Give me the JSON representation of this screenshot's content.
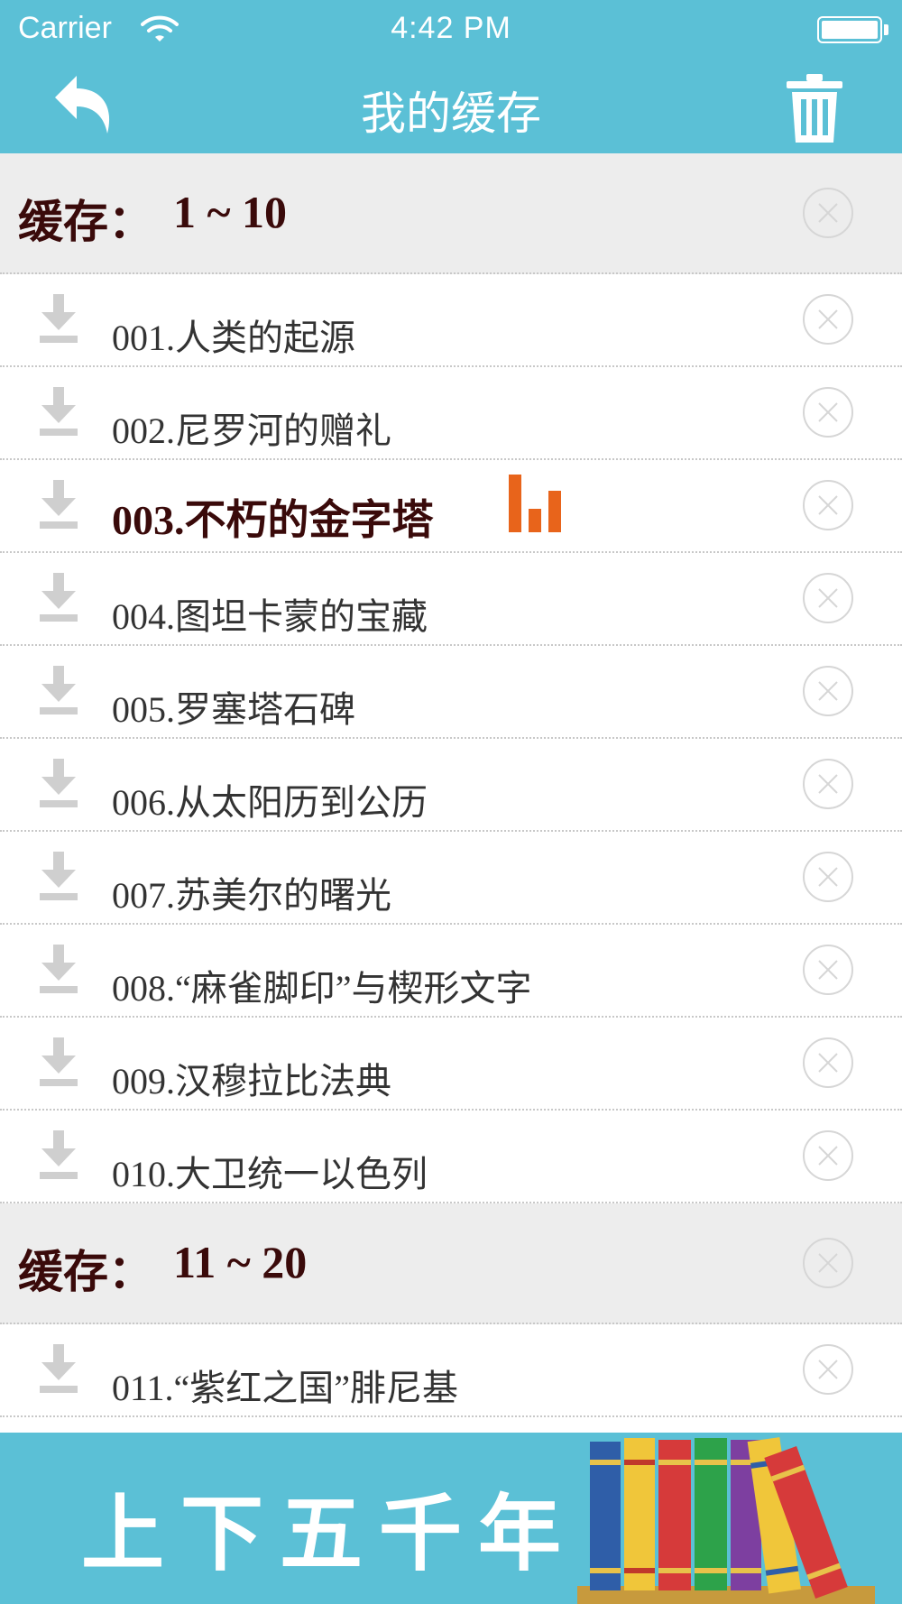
{
  "status_bar": {
    "carrier": "Carrier",
    "time": "4:42 PM"
  },
  "nav": {
    "title": "我的缓存",
    "back_icon": "back-arrow-icon",
    "trash_icon": "trash-icon"
  },
  "sections": [
    {
      "label": "缓存：",
      "range": "1 ~ 10",
      "items": [
        {
          "title": "001.人类的起源",
          "active": false
        },
        {
          "title": "002.尼罗河的赠礼",
          "active": false
        },
        {
          "title": "003.不朽的金字塔",
          "active": true
        },
        {
          "title": "004.图坦卡蒙的宝藏",
          "active": false
        },
        {
          "title": "005.罗塞塔石碑",
          "active": false
        },
        {
          "title": "006.从太阳历到公历",
          "active": false
        },
        {
          "title": "007.苏美尔的曙光",
          "active": false
        },
        {
          "title": "008.“麻雀脚印”与楔形文字",
          "active": false
        },
        {
          "title": "009.汉穆拉比法典",
          "active": false
        },
        {
          "title": "010.大卫统一以色列",
          "active": false
        }
      ]
    },
    {
      "label": "缓存：",
      "range": "11 ~ 20",
      "items": [
        {
          "title": "011.“紫红之国”腓尼基",
          "active": false
        }
      ]
    }
  ],
  "banner": {
    "text": "上下五千年"
  },
  "colors": {
    "accent": "#5bc0d6",
    "active_text": "#3a0a0a",
    "playing_indicator": "#e8641b"
  }
}
